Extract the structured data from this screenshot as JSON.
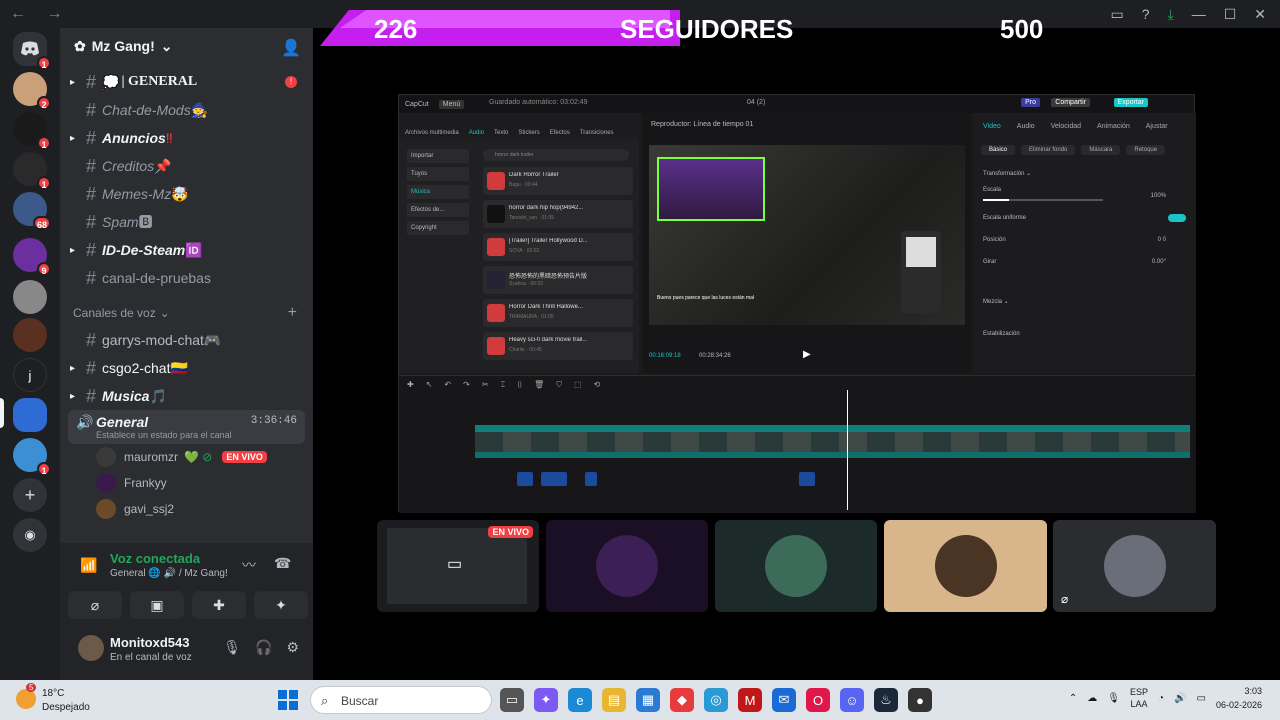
{
  "window": {
    "nav": "← →",
    "controls": [
      "▭",
      "?",
      "⤓",
      "—",
      "☐",
      "✕"
    ]
  },
  "banner": {
    "current": "226",
    "label": "SEGUIDORES",
    "goal": "500"
  },
  "server": {
    "name": "Mz Gang!"
  },
  "channels": [
    {
      "name": "| GENERAL",
      "emoji": "💭",
      "unread": "!",
      "style": "mono",
      "expand": true
    },
    {
      "name": "Chat-de-Mods",
      "emoji": "🧙",
      "style": "it"
    },
    {
      "name": "Anuncios",
      "emoji": "‼",
      "style": "bold",
      "expand": true
    },
    {
      "name": "Creditos",
      "emoji": "📌",
      "style": "it"
    },
    {
      "name": "Memes-Mz",
      "emoji": "🤯",
      "style": "it"
    },
    {
      "name": "Spam",
      "emoji": "🅱",
      "style": "it"
    },
    {
      "name": "ID-De-Steam",
      "emoji": "🆔",
      "style": "bold",
      "expand": true
    },
    {
      "name": "canal-de-pruebas",
      "emoji": "",
      "style": ""
    }
  ],
  "voice_category": "Canales de voz",
  "voice_channels": [
    {
      "name": "garrys-mod-chat",
      "emoji": "🎮"
    },
    {
      "name": "csgo2-chat",
      "emoji": "🇨🇴",
      "expand": true
    },
    {
      "name": "Musica",
      "emoji": "🎵",
      "expand": true
    }
  ],
  "active_voice": {
    "name": "General",
    "time": "3:36:46",
    "status": "Establece un estado para el canal"
  },
  "voice_users": [
    {
      "name": "mauromzr",
      "live": "EN VIVO"
    },
    {
      "name": "Frankyy"
    },
    {
      "name": "gavi_ssj2"
    }
  ],
  "voice_panel": {
    "title": "Voz conectada",
    "sub": "General 🌐 🔊 / Mz Gang!"
  },
  "user": {
    "name": "Monitoxd543",
    "status": "En el canal de voz"
  },
  "rail_badges": [
    "1",
    "2",
    "1",
    "1",
    "68",
    "9",
    "1"
  ],
  "capcut": {
    "app": "CapCut",
    "menu": "Menú",
    "autosave": "Guardado automático: 03:02:49",
    "project": "04 (2)",
    "pro": "Pro",
    "share": "Compartir",
    "export": "Exportar",
    "tabs": [
      "Archivos multimedia",
      "Audio",
      "Texto",
      "Stickers",
      "Efectos",
      "Transiciones"
    ],
    "categories": [
      "Importar",
      "Tuyos",
      "Música",
      "Efectos de...",
      "Copyright"
    ],
    "search": "horror dark trailer",
    "tracks": [
      {
        "title": "Dark Horror Trailer",
        "sub": "Bagu · 00:44"
      },
      {
        "title": "horror dark hip hop(94942...",
        "sub": "Tanoshi_san · 01:05"
      },
      {
        "title": "[Trailer] Trailer Hollywood D...",
        "sub": "SOVA · 02:02"
      },
      {
        "title": "恐怖恐怖的黑暗恐怖预告片版",
        "sub": "Syahna · 00:33"
      },
      {
        "title": "Horror Dark Thrill Hallowe...",
        "sub": "TRAMAURA · 01:05"
      },
      {
        "title": "Heavy sci-fi dark movie trail...",
        "sub": "Charlie · 00:45"
      }
    ],
    "player_title": "Reproductor: Línea de tiempo 01",
    "time_current": "00:16:09:18",
    "time_total": "00:28:34:26",
    "caption": "Bueno pues parece que las luces están mal",
    "right_tabs": [
      "Video",
      "Audio",
      "Velocidad",
      "Animación",
      "Ajustar"
    ],
    "right_sub": [
      "Básico",
      "Eliminar fondo",
      "Máscara",
      "Retoque"
    ],
    "props": [
      {
        "label": "Transformación ⌄"
      },
      {
        "label": "Escala",
        "value": "100%"
      },
      {
        "label": "Escala uniforme"
      },
      {
        "label": "Posición",
        "value": "0   0"
      },
      {
        "label": "Girar",
        "value": "0.00°"
      },
      {
        "label": "Mezcla ⌄"
      },
      {
        "label": "Estabilización"
      }
    ],
    "scale_level": 0.22
  },
  "tiles": [
    {
      "live": "EN VIVO",
      "bg": "#1b1c1f"
    },
    {
      "bg": "#1a0f24"
    },
    {
      "bg": "#1c2a2a"
    },
    {
      "bg": "#d9b58c"
    },
    {
      "bg": "#2b2c30"
    }
  ],
  "taskbar": {
    "temp": "18°C",
    "weather": "Despejado",
    "weather_badge": "5",
    "search_placeholder": "Buscar",
    "lang1": "ESP",
    "lang2": "LAA",
    "time": "3:03",
    "date": "06-02-2026"
  }
}
